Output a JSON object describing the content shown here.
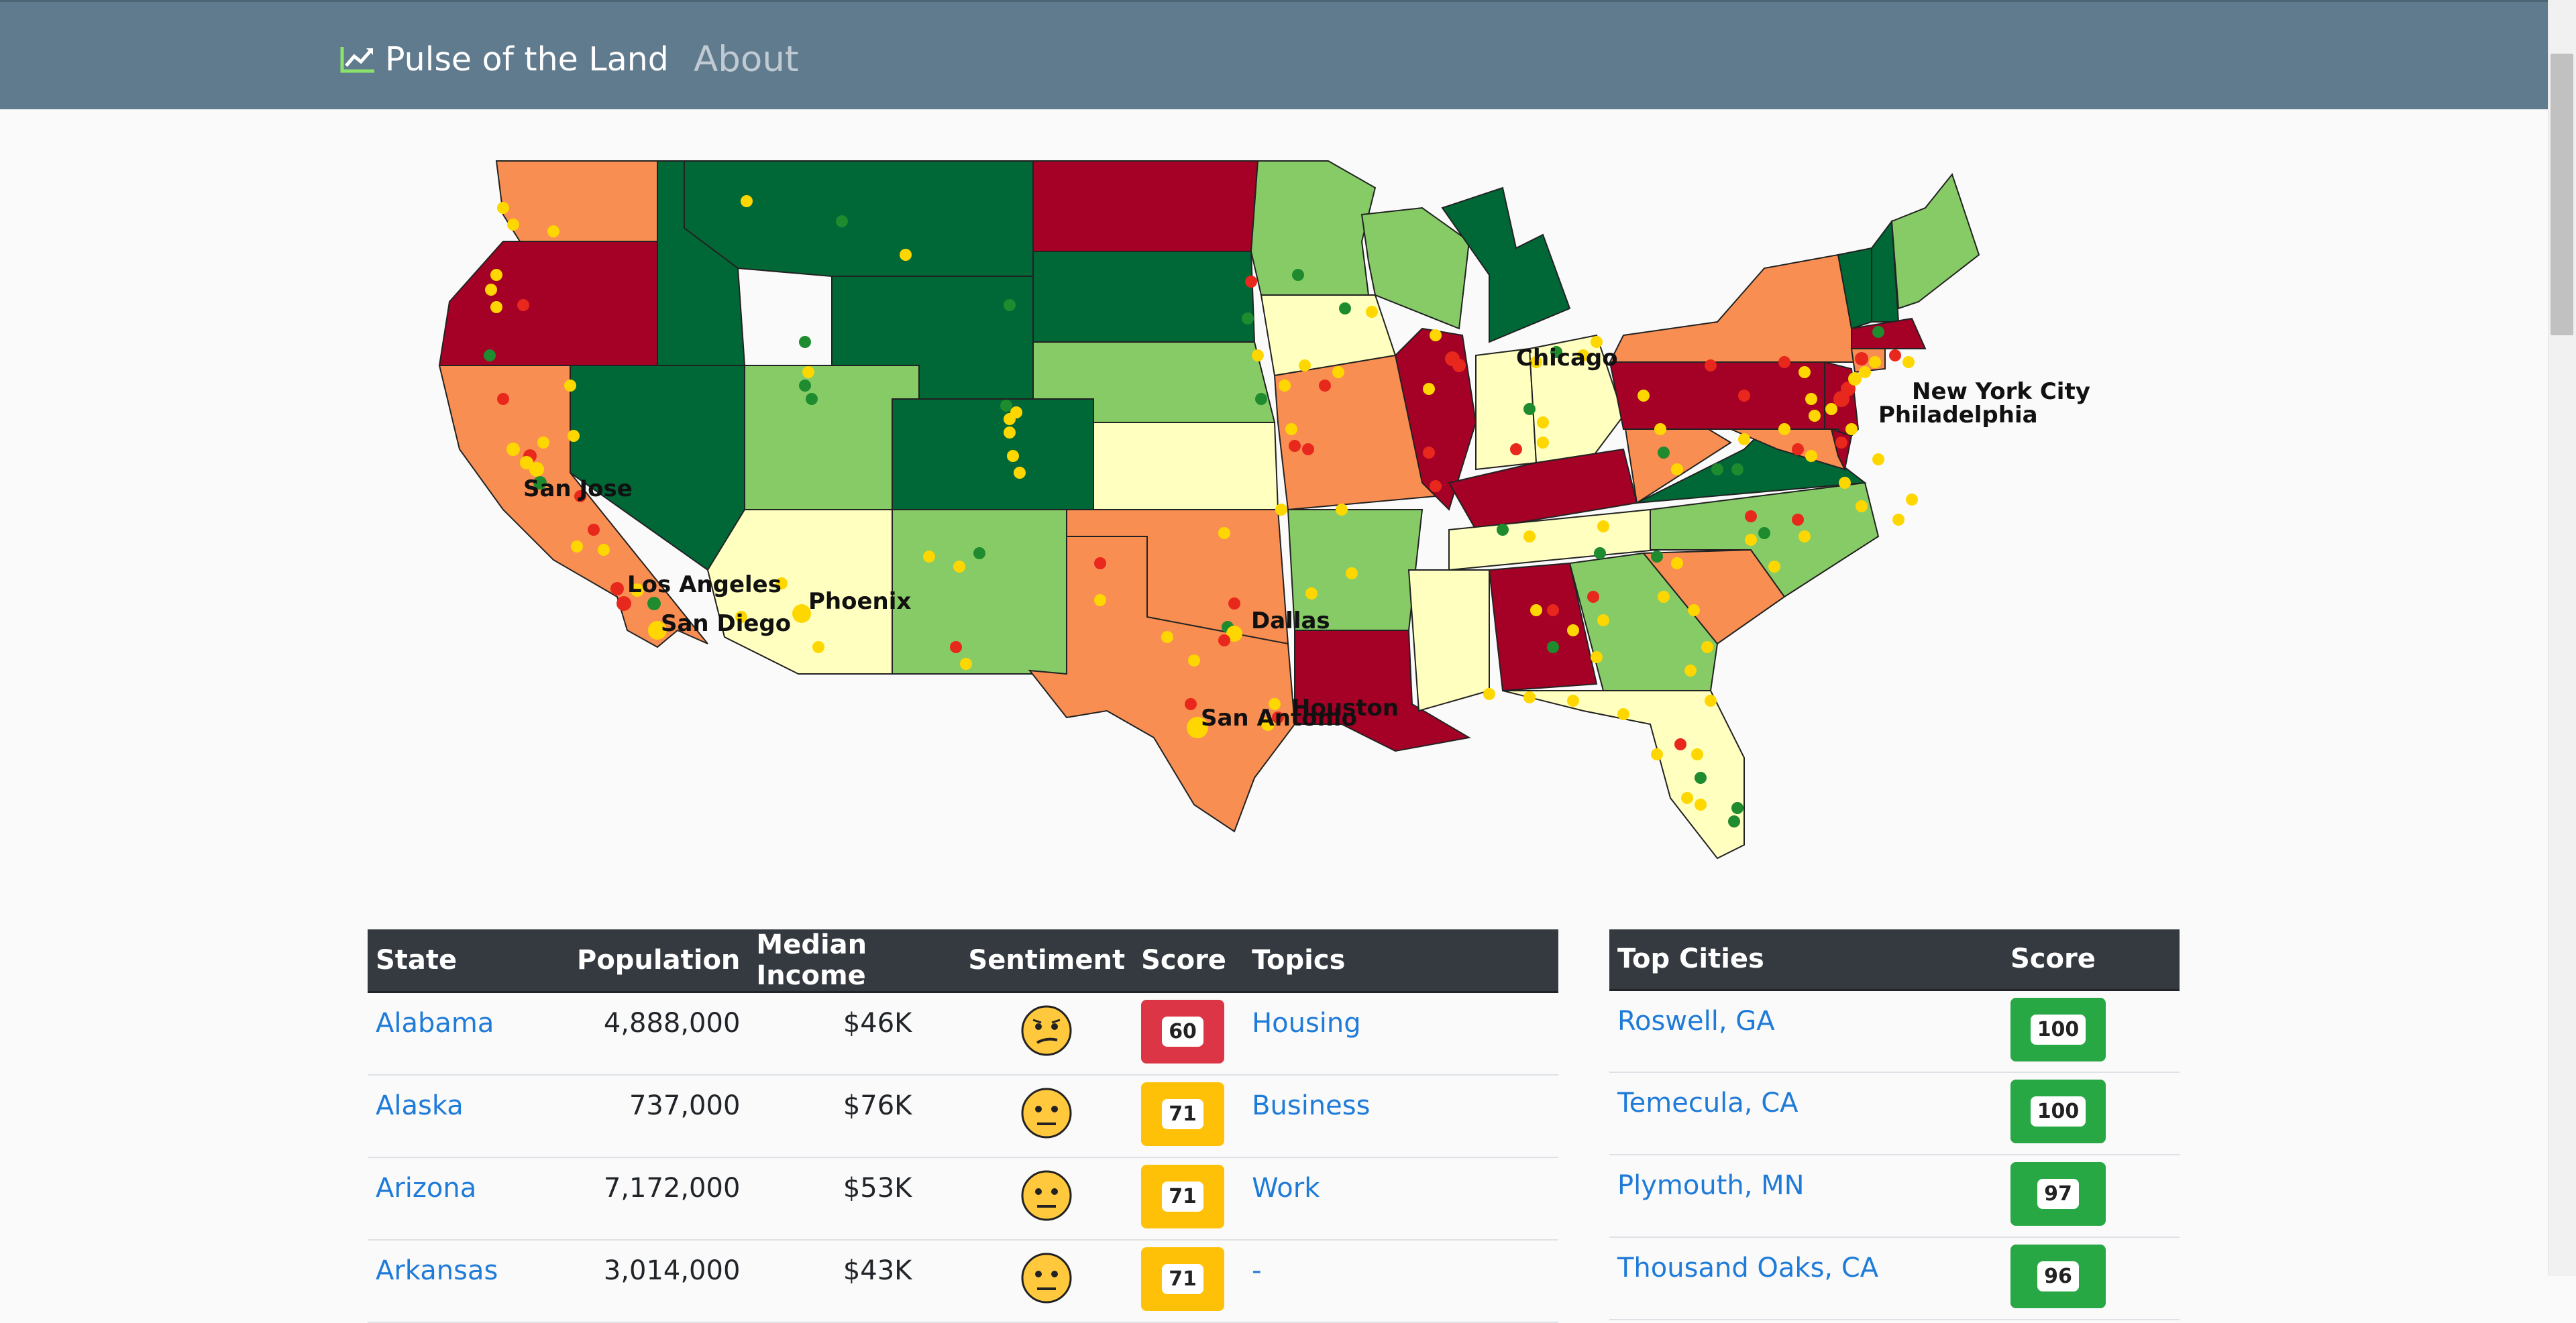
{
  "navbar": {
    "brand": "Pulse of the Land",
    "about": "About",
    "bg_color": "#607a8e"
  },
  "map": {
    "cities": [
      "Chicago",
      "New York City",
      "Philadelphia",
      "San Jose",
      "Los Angeles",
      "San Diego",
      "Phoenix",
      "Dallas",
      "Houston",
      "San Antonio"
    ],
    "colors": {
      "very_negative": "#a50026",
      "negative": "#f98e52",
      "neutral": "#ffffbf",
      "positive": "#86cb66",
      "very_positive": "#006837"
    }
  },
  "states_table": {
    "headers": [
      "State",
      "Population",
      "Median Income",
      "Sentiment",
      "Score",
      "Topics"
    ],
    "rows": [
      {
        "state": "Alabama",
        "population": "4,888,000",
        "income": "$46K",
        "sentiment": "confused",
        "score": "60",
        "score_color": "#dc3545",
        "topic": "Housing"
      },
      {
        "state": "Alaska",
        "population": "737,000",
        "income": "$76K",
        "sentiment": "neutral",
        "score": "71",
        "score_color": "#ffc107",
        "topic": "Business"
      },
      {
        "state": "Arizona",
        "population": "7,172,000",
        "income": "$53K",
        "sentiment": "neutral",
        "score": "71",
        "score_color": "#ffc107",
        "topic": "Work"
      },
      {
        "state": "Arkansas",
        "population": "3,014,000",
        "income": "$43K",
        "sentiment": "neutral",
        "score": "71",
        "score_color": "#ffc107",
        "topic": "-"
      }
    ]
  },
  "cities_table": {
    "headers": [
      "Top Cities",
      "Score"
    ],
    "rows": [
      {
        "city": "Roswell, GA",
        "score": "100",
        "score_color": "#28a745"
      },
      {
        "city": "Temecula, CA",
        "score": "100",
        "score_color": "#28a745"
      },
      {
        "city": "Plymouth, MN",
        "score": "97",
        "score_color": "#28a745"
      },
      {
        "city": "Thousand Oaks, CA",
        "score": "96",
        "score_color": "#28a745"
      }
    ]
  }
}
